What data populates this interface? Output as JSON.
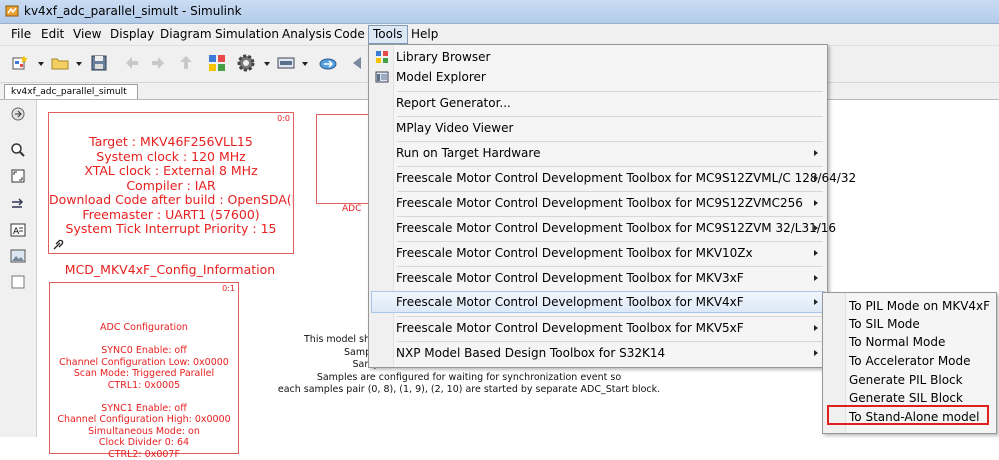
{
  "window": {
    "title": "kv4xf_adc_parallel_simult - Simulink"
  },
  "menubar": [
    "File",
    "Edit",
    "View",
    "Display",
    "Diagram",
    "Simulation",
    "Analysis",
    "Code",
    "Tools",
    "Help"
  ],
  "tab": {
    "label": "kv4xf_adc_parallel_simult"
  },
  "canvas": {
    "config_block": {
      "corner": "0:0",
      "lines": [
        "Target : MKV46F256VLL15",
        "System clock : 120 MHz",
        "XTAL clock : External 8 MHz",
        "Compiler : IAR",
        "Download Code after build : OpenSDA(E:",
        "Freemaster : UART1 (57600)",
        "System Tick Interrupt Priority : 15"
      ],
      "name": "MCD_MKV4xF_Config_Information"
    },
    "adc_block": {
      "corner": "0:1",
      "lines": [
        "ADC Configuration",
        "",
        "SYNC0 Enable: off",
        "Channel Configuration Low: 0x0000",
        "Scan Mode: Triggered Parallel",
        "CTRL1: 0x0005",
        "",
        "SYNC1 Enable: off",
        "Channel Configuration High: 0x0000",
        "Simultaneous Mode: on",
        "Clock Divider 0: 64",
        "CTRL2: 0x007F"
      ]
    },
    "adc_small_label": "ADC",
    "note_lines": [
      "This model sh",
      "Samp",
      "Samples 8, 9, 10 are used for ADCB conversions.",
      "Samples are configured for waiting for synchronization event so",
      "each samples pair (0, 8), (1, 9), (2, 10) are started by separate ADC_Start block."
    ]
  },
  "tools_menu": {
    "items": [
      {
        "label": "Library Browser",
        "submenu": false
      },
      {
        "label": "Model Explorer",
        "submenu": false
      },
      {
        "label": "Report Generator...",
        "submenu": false
      },
      {
        "label": "MPlay Video Viewer",
        "submenu": false
      },
      {
        "label": "Run on Target Hardware",
        "submenu": true
      },
      {
        "label": "Freescale Motor Control Development Toolbox for MC9S12ZVML/C 128/64/32",
        "submenu": true
      },
      {
        "label": "Freescale Motor Control Development Toolbox for MC9S12ZVMC256",
        "submenu": true
      },
      {
        "label": "Freescale Motor Control Development Toolbox for MC9S12ZVM 32/L31/16",
        "submenu": true
      },
      {
        "label": "Freescale Motor Control Development Toolbox for MKV10Zx",
        "submenu": true
      },
      {
        "label": "Freescale Motor Control Development Toolbox for MKV3xF",
        "submenu": true
      },
      {
        "label": "Freescale Motor Control Development Toolbox for MKV4xF",
        "submenu": true
      },
      {
        "label": "Freescale Motor Control Development Toolbox for MKV5xF",
        "submenu": true
      },
      {
        "label": "NXP Model Based Design Toolbox for S32K14",
        "submenu": true
      }
    ]
  },
  "submenu_mkv4xf": {
    "items": [
      "To PIL Mode on MKV4xF",
      "To SIL Mode",
      "To Normal Mode",
      "To Accelerator Mode",
      "Generate PIL Block",
      "Generate SIL Block",
      "To Stand-Alone model"
    ],
    "highlighted": "To Stand-Alone model",
    "highlight_color": "#e0201c"
  },
  "colors": {
    "block_text": "#e82020",
    "block_border": "#e06060",
    "menu_highlight": "#dde9f7"
  }
}
